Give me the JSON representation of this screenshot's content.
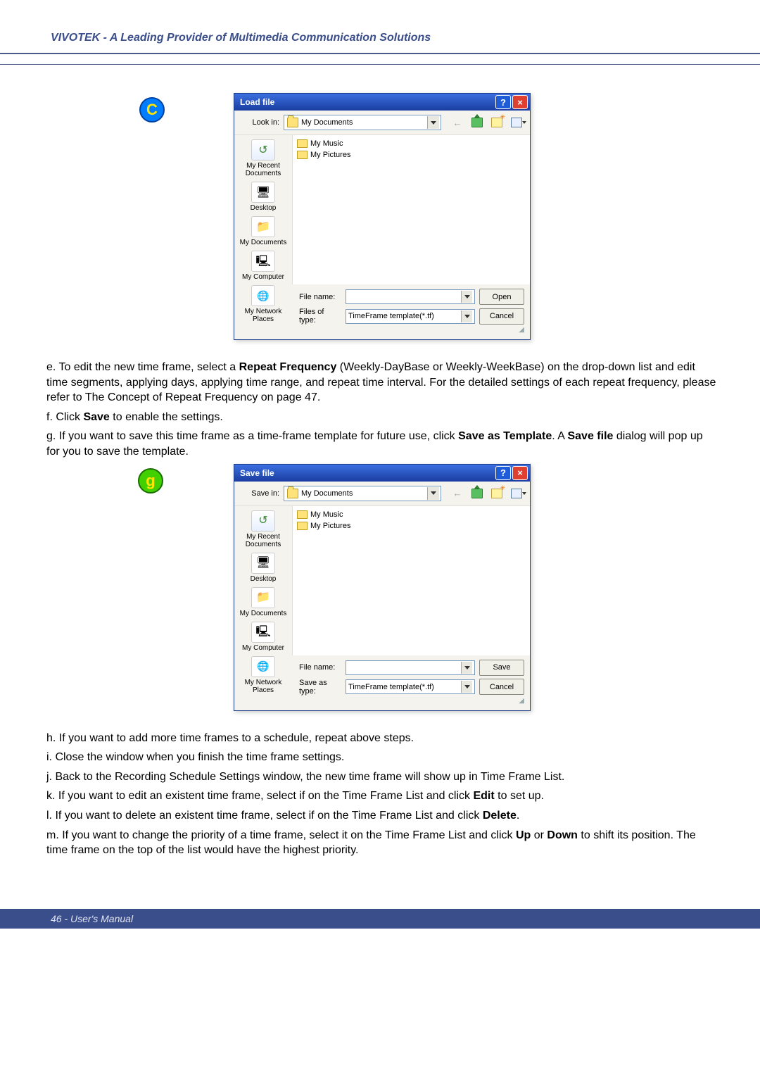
{
  "header": {
    "title": "VIVOTEK - A Leading Provider of Multimedia Communication Solutions"
  },
  "badges": {
    "c": "C",
    "g": "g"
  },
  "loadDialog": {
    "title": "Load file",
    "lookInLabel": "Look in:",
    "lookInValue": "My Documents",
    "places": [
      "My Recent Documents",
      "Desktop",
      "My Documents",
      "My Computer",
      "My Network Places"
    ],
    "files": [
      "My Music",
      "My Pictures"
    ],
    "fileNameLabel": "File name:",
    "fileNameValue": "",
    "typeLabel": "Files of type:",
    "typeValue": "TimeFrame template(*.tf)",
    "primaryBtn": "Open",
    "cancelBtn": "Cancel"
  },
  "saveDialog": {
    "title": "Save file",
    "lookInLabel": "Save in:",
    "lookInValue": "My Documents",
    "places": [
      "My Recent Documents",
      "Desktop",
      "My Documents",
      "My Computer",
      "My Network Places"
    ],
    "files": [
      "My Music",
      "My Pictures"
    ],
    "fileNameLabel": "File name:",
    "fileNameValue": "",
    "typeLabel": "Save as type:",
    "typeValue": "TimeFrame template(*.tf)",
    "primaryBtn": "Save",
    "cancelBtn": "Cancel"
  },
  "text": {
    "e_pre": "e. To edit the new time frame, select a ",
    "e_b1": "Repeat Frequency",
    "e_post": " (Weekly-DayBase or Weekly-WeekBase) on the drop-down list and edit time segments, applying days, applying time range, and repeat time interval. For the detailed settings of each repeat frequency, please refer to The Concept of Repeat Frequency on page 47.",
    "f_pre": "f. Click ",
    "f_b": "Save",
    "f_post": " to enable the settings.",
    "g_pre": "g. If you want to save this time frame as a time-frame template for future use, click ",
    "g_b1": "Save as Template",
    "g_mid": ". A ",
    "g_b2": "Save file",
    "g_post": " dialog will pop up for you to save the template.",
    "h": "h. If you want to add more time frames to a schedule, repeat above steps.",
    "i": "i. Close the window when you finish the time frame settings.",
    "j": "j. Back to the Recording Schedule Settings window, the new time frame will show up in Time Frame List.",
    "k_pre": "k. If you want to edit an existent time frame, select if on the Time Frame List and click ",
    "k_b": "Edit",
    "k_post": " to set up.",
    "l_pre": "l. If you want to delete an existent time frame, select if on the Time Frame List and click ",
    "l_b": "Delete",
    "l_post": ".",
    "m_pre": "m. If you want to change the priority of a time frame, select it on the Time Frame List and click ",
    "m_b1": "Up",
    "m_mid": " or ",
    "m_b2": "Down",
    "m_post": " to shift its position. The time frame on the top of the list would have the highest priority."
  },
  "footer": "46 - User's Manual"
}
